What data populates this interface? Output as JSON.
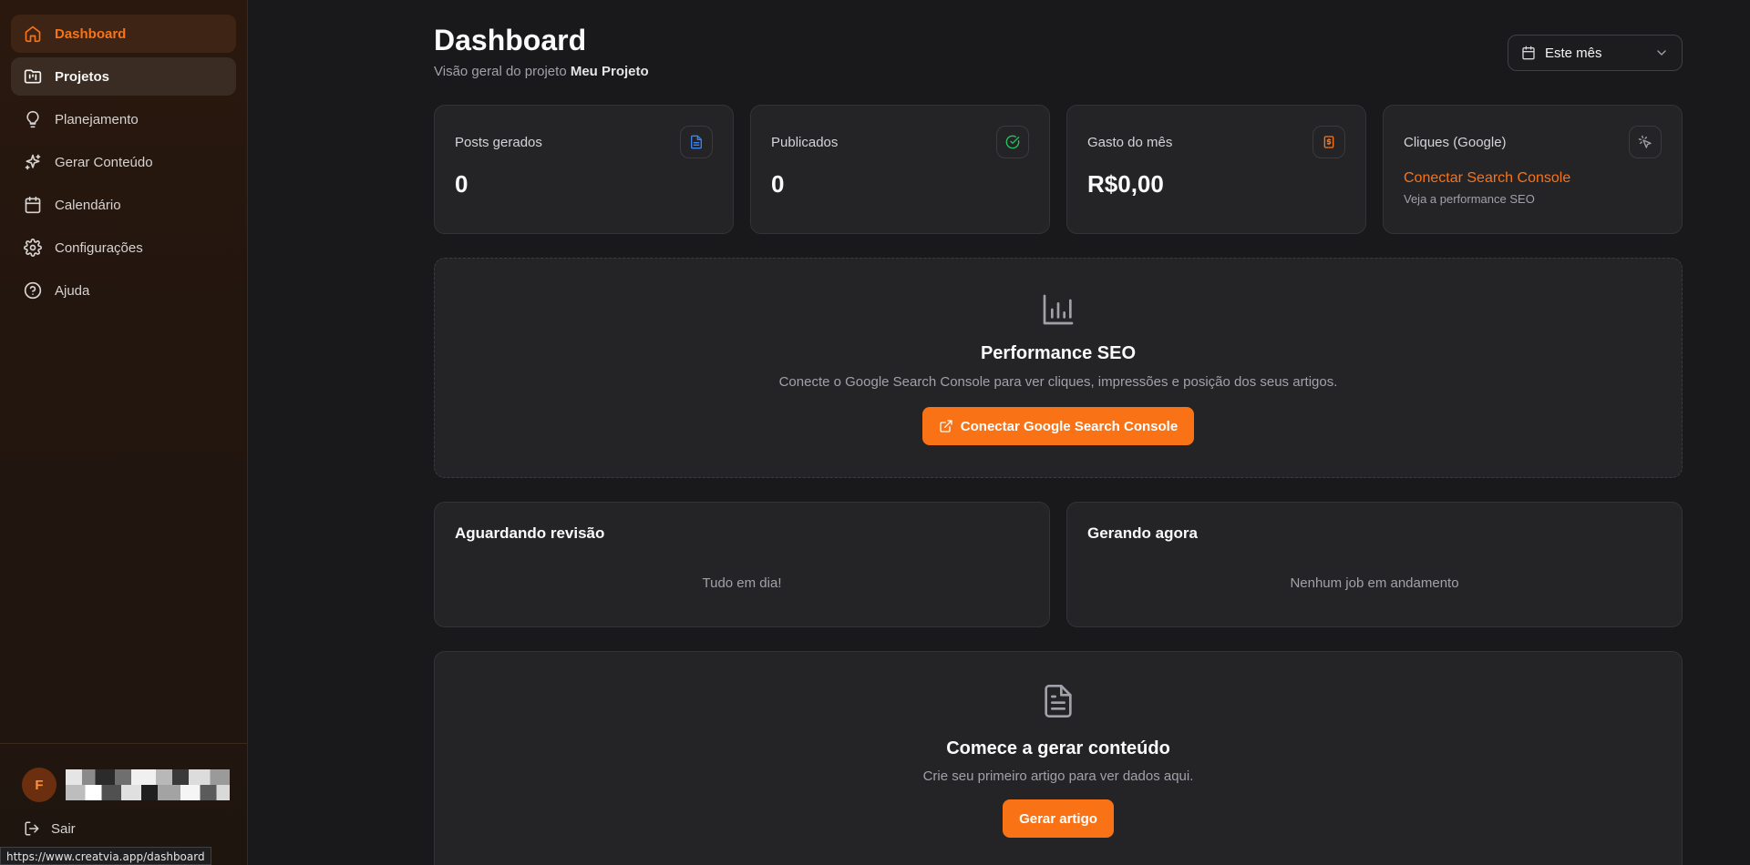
{
  "sidebar": {
    "items": [
      {
        "label": "Dashboard",
        "icon": "home-icon",
        "state": "active"
      },
      {
        "label": "Projetos",
        "icon": "folder-kanban-icon",
        "state": "hover"
      },
      {
        "label": "Planejamento",
        "icon": "lightbulb-icon",
        "state": ""
      },
      {
        "label": "Gerar Conteúdo",
        "icon": "sparkles-icon",
        "state": ""
      },
      {
        "label": "Calendário",
        "icon": "calendar-icon",
        "state": ""
      },
      {
        "label": "Configurações",
        "icon": "gear-icon",
        "state": ""
      },
      {
        "label": "Ajuda",
        "icon": "help-circle-icon",
        "state": ""
      }
    ],
    "user": {
      "initial": "F"
    },
    "logout_label": "Sair"
  },
  "status_bar": {
    "url": "https://www.creatvia.app/dashboard"
  },
  "header": {
    "title": "Dashboard",
    "subtitle_prefix": "Visão geral do projeto",
    "project_name": "Meu Projeto",
    "period_select": "Este mês"
  },
  "stats": [
    {
      "label": "Posts gerados",
      "value": "0",
      "icon": "file-text-icon",
      "icon_color": "#3b82f6"
    },
    {
      "label": "Publicados",
      "value": "0",
      "icon": "check-circle-icon",
      "icon_color": "#22c55e"
    },
    {
      "label": "Gasto do mês",
      "value": "R$0,00",
      "icon": "receipt-dollar-icon",
      "icon_color": "#f97316"
    },
    {
      "label": "Cliques (Google)",
      "link": "Conectar Search Console",
      "hint": "Veja a performance SEO",
      "icon": "mouse-pointer-click-icon",
      "icon_color": "#a1a1aa"
    }
  ],
  "seo": {
    "title": "Performance SEO",
    "description": "Conecte o Google Search Console para ver cliques, impressões e posição dos seus artigos.",
    "button": "Conectar Google Search Console"
  },
  "review": {
    "title": "Aguardando revisão",
    "empty": "Tudo em dia!"
  },
  "generating": {
    "title": "Gerando agora",
    "empty": "Nenhum job em andamento"
  },
  "start": {
    "title": "Comece a gerar conteúdo",
    "description": "Crie seu primeiro artigo para ver dados aqui.",
    "button": "Gerar artigo"
  },
  "colors": {
    "accent": "#f97316",
    "background": "#19191b",
    "card": "#242427"
  }
}
